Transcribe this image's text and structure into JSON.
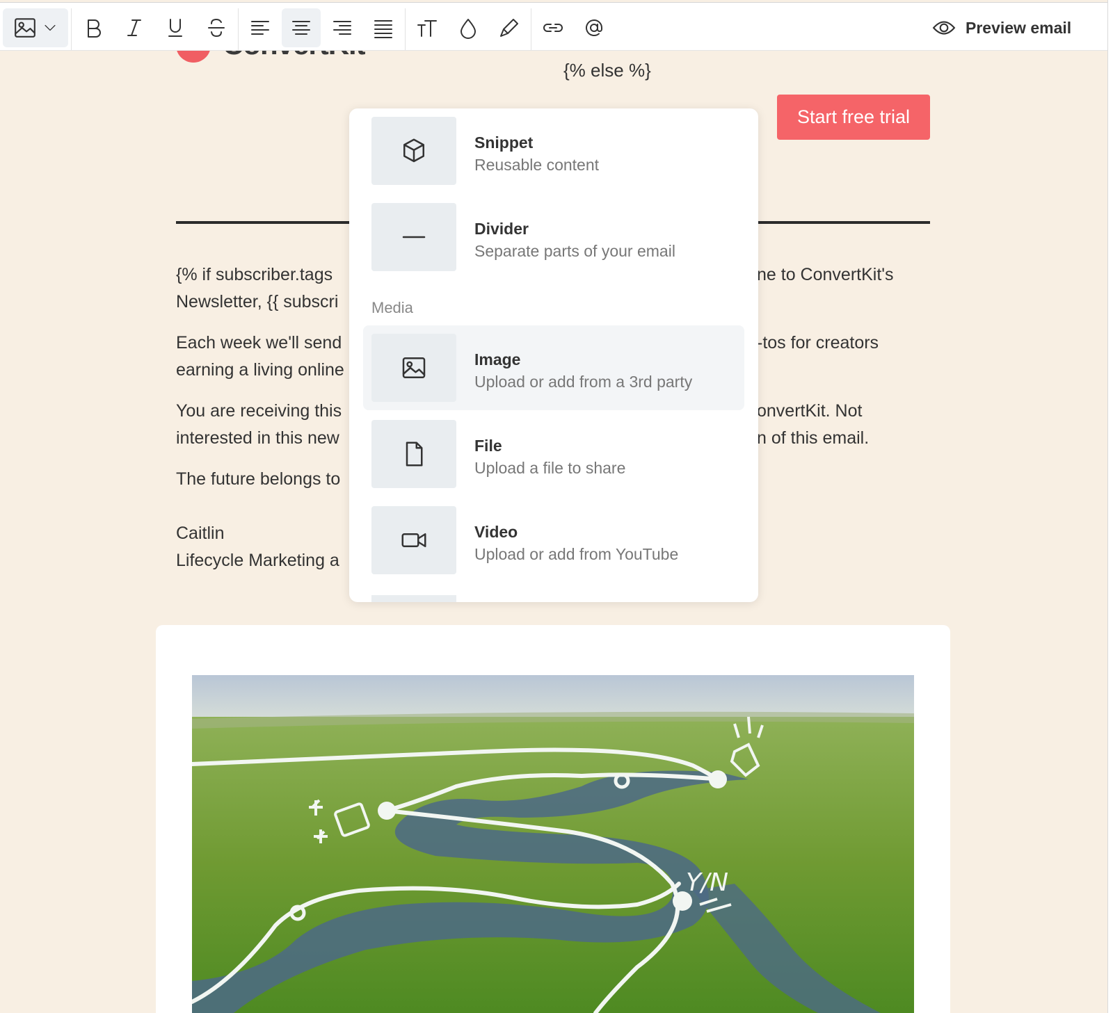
{
  "toolbar": {
    "items": [
      {
        "name": "image-dropdown"
      },
      {
        "name": "bold",
        "glyph": "B"
      },
      {
        "name": "italic"
      },
      {
        "name": "underline"
      },
      {
        "name": "strikethrough"
      },
      {
        "name": "align-left"
      },
      {
        "name": "align-center",
        "active": true
      },
      {
        "name": "align-right"
      },
      {
        "name": "align-justify"
      },
      {
        "name": "text-size",
        "glyph": "TT"
      },
      {
        "name": "color"
      },
      {
        "name": "highlight"
      },
      {
        "name": "link"
      },
      {
        "name": "mention"
      }
    ],
    "preview_label": "Preview email"
  },
  "email": {
    "logo_text": "ConvertKit",
    "else_tag": "{% else %}",
    "cta_label": "Start free trial",
    "paragraphs": [
      {
        "lines": [
          {
            "left": "{% if subscriber.tags",
            "right": "ne to ConvertKit's"
          },
          {
            "left": "Newsletter, {{ subscri",
            "right": ""
          }
        ]
      },
      {
        "lines": [
          {
            "left": "Each week we'll send",
            "right": "-tos for creators"
          },
          {
            "left": "earning a living online",
            "right": ""
          }
        ]
      },
      {
        "lines": [
          {
            "left": "You are receiving this",
            "right": "onvertKit. Not"
          },
          {
            "left": "interested in this new",
            "right": "n of this email."
          }
        ]
      },
      {
        "lines": [
          {
            "left": "The future belongs to",
            "right": ""
          }
        ]
      },
      {
        "lines": [
          {
            "left": "Caitlin",
            "right": ""
          },
          {
            "left": "Lifecycle Marketing a",
            "right": ""
          }
        ]
      }
    ]
  },
  "menu": {
    "items": [
      {
        "title": "Snippet",
        "desc": "Reusable content",
        "icon": "cube-icon"
      },
      {
        "title": "Divider",
        "desc": "Separate parts of your email",
        "icon": "minus-icon"
      }
    ],
    "media_heading": "Media",
    "media_items": [
      {
        "title": "Image",
        "desc": "Upload or add from a 3rd party",
        "icon": "image-icon",
        "highlighted": true
      },
      {
        "title": "File",
        "desc": "Upload a file to share",
        "icon": "file-icon"
      },
      {
        "title": "Video",
        "desc": "Upload or add from YouTube",
        "icon": "video-icon"
      }
    ]
  },
  "hero_annotation": "Y/N",
  "colors": {
    "canvas_bg": "#f8efe3",
    "cta": "#f56468",
    "logo": "#f05e63",
    "menu_icon_bg": "#e9edf0",
    "highlight_bg": "#f3f5f7"
  }
}
